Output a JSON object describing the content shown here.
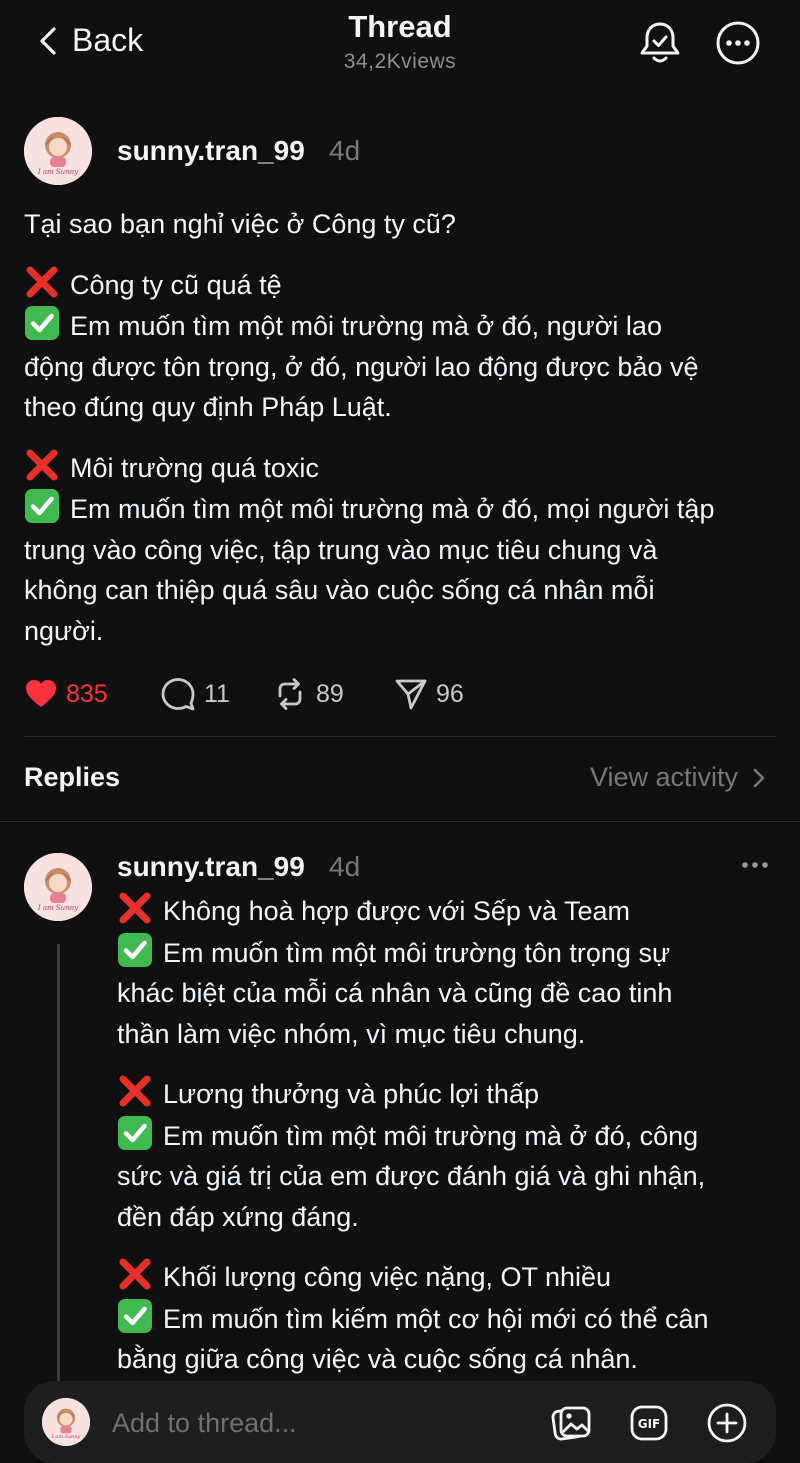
{
  "header": {
    "back_label": "Back",
    "title": "Thread",
    "views": "34,2Kviews"
  },
  "post": {
    "username": "sunny.tran_99",
    "time": "4d",
    "avatar_text": "I am Sunny",
    "question": "Tại sao bạn nghỉ việc ở Công ty cũ?",
    "blocks": [
      {
        "bad": "Công ty cũ quá tệ",
        "good_lines": [
          "Em muốn tìm một môi trường mà ở đó, người lao",
          "động được tôn trọng, ở đó, người lao động được bảo vệ",
          "theo đúng quy định Pháp Luật."
        ]
      },
      {
        "bad": "Môi trường quá toxic",
        "good_lines": [
          "Em muốn tìm một môi trường mà ở đó, mọi người tập",
          "trung vào công việc, tập trung vào mục tiêu chung và",
          "không can thiệp quá sâu vào cuộc sống cá nhân mỗi",
          "người."
        ]
      }
    ],
    "stats": {
      "likes": "835",
      "comments": "11",
      "reposts": "89",
      "shares": "96"
    }
  },
  "replies": {
    "title": "Replies",
    "view_activity": "View activity"
  },
  "reply": {
    "username": "sunny.tran_99",
    "time": "4d",
    "blocks": [
      {
        "bad": "Không hoà hợp được với Sếp và Team",
        "good_lines": [
          "Em muốn tìm một môi trường tôn trọng sự",
          "khác biệt của mỗi cá nhân và cũng đề cao tinh",
          "thần làm việc nhóm, vì mục tiêu chung."
        ]
      },
      {
        "bad": "Lương thưởng và phúc lợi thấp",
        "good_lines": [
          "Em muốn tìm một môi trường mà ở đó, công",
          "sức và giá trị của em được đánh giá và ghi nhận,",
          "đền đáp xứng đáng."
        ]
      },
      {
        "bad": "Khối lượng công việc nặng, OT nhiều",
        "good_lines": [
          "Em muốn tìm kiếm một cơ hội mới có thể cân",
          "bằng giữa công việc và cuộc sống cá nhân."
        ]
      }
    ]
  },
  "composer": {
    "placeholder": "Add to thread..."
  },
  "colors": {
    "background": "#101010",
    "text": "#f3f5f7",
    "muted": "#777777",
    "like": "#ff3040",
    "check": "#3fb950",
    "cross": "#e5302a"
  },
  "icons": [
    "chevron-left-icon",
    "bell-icon",
    "more-circle-icon",
    "heart-icon",
    "comment-icon",
    "repost-icon",
    "share-icon",
    "chevron-right-icon",
    "more-dots-icon",
    "image-icon",
    "gif-icon",
    "plus-circle-icon"
  ]
}
